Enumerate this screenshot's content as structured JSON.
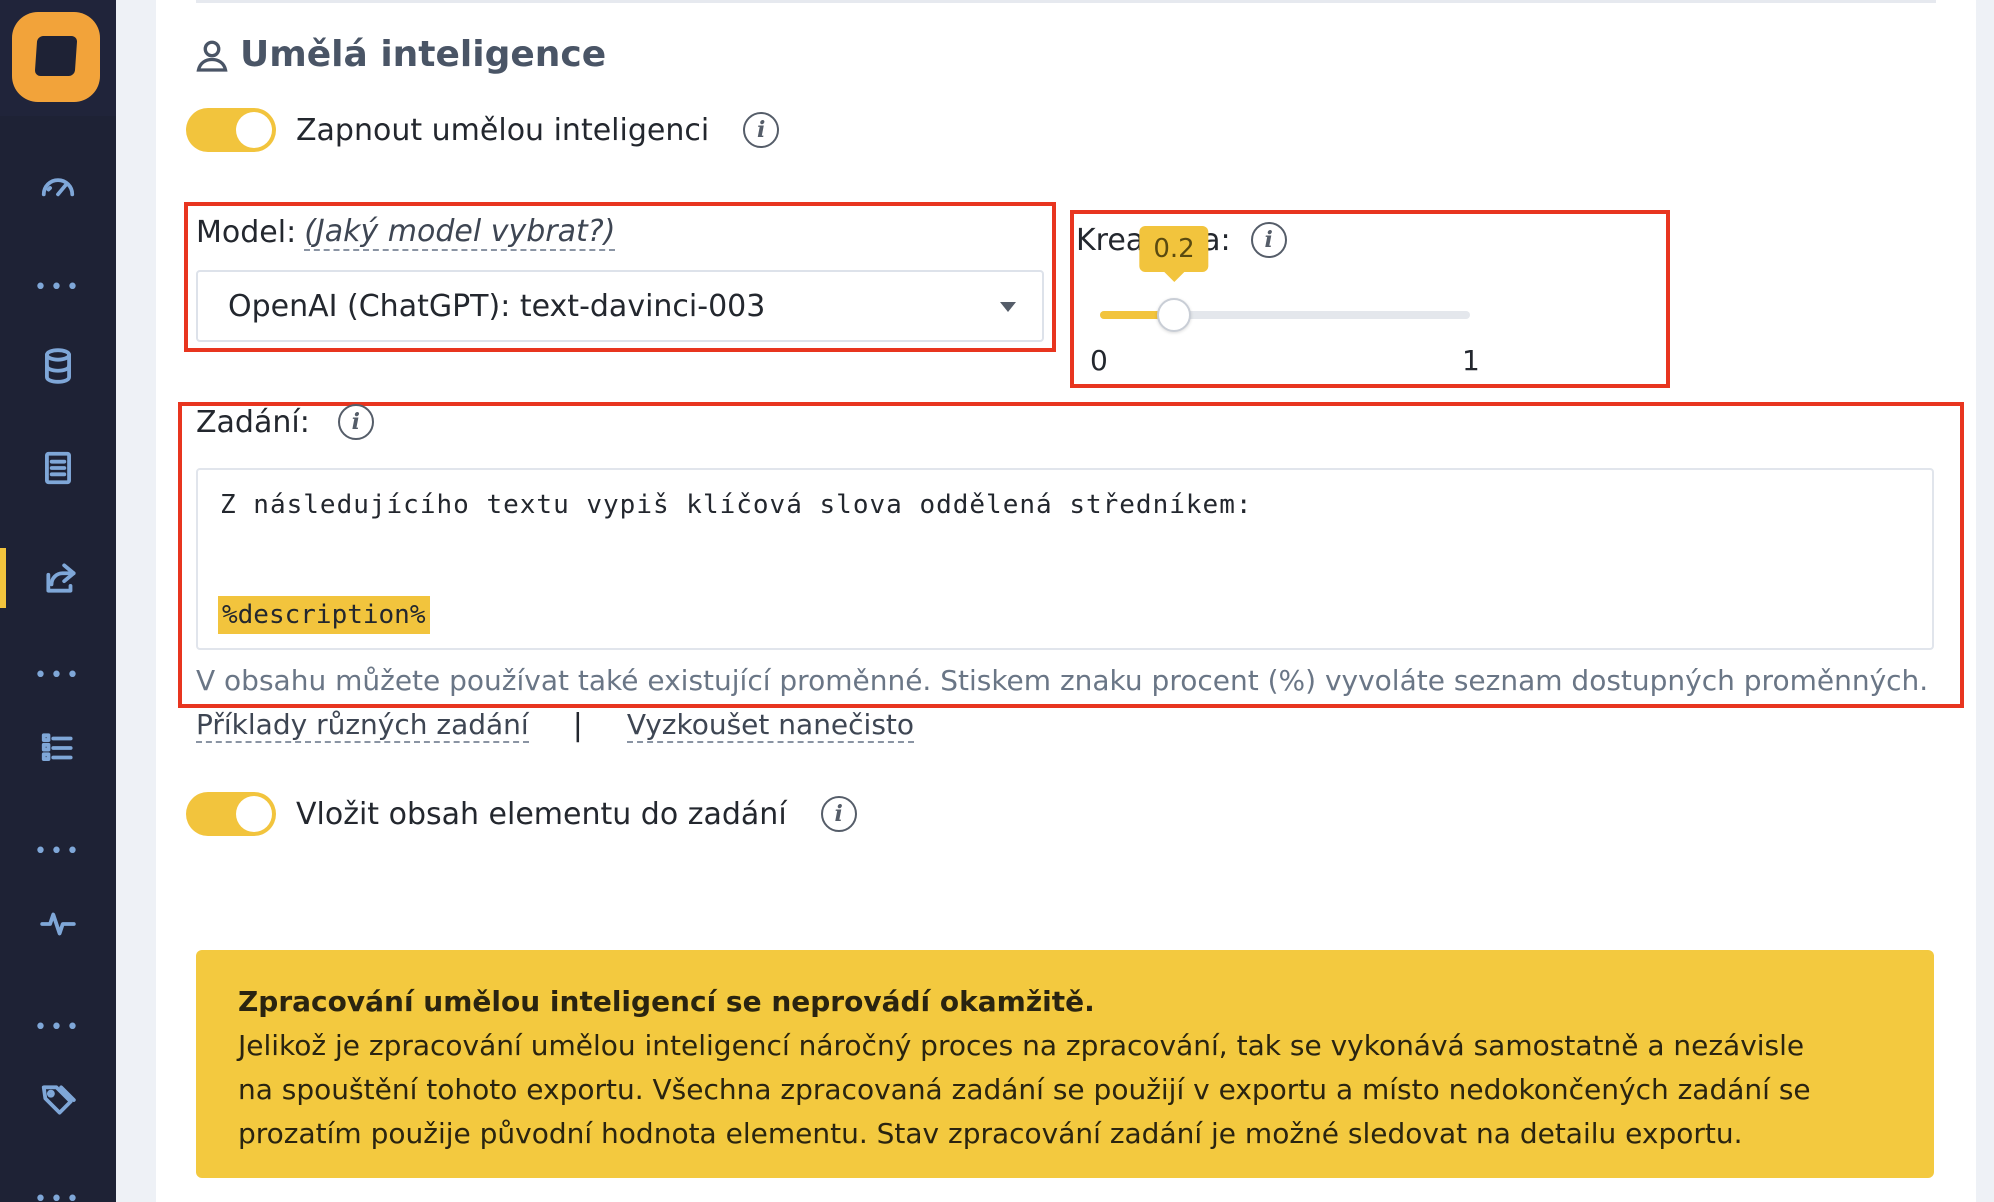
{
  "sidebar": {
    "logo": "app-logo",
    "items": [
      {
        "icon": "speedometer-icon"
      },
      {
        "icon": "database-icon"
      },
      {
        "icon": "document-icon"
      },
      {
        "icon": "export-share-icon",
        "active": true
      },
      {
        "icon": "list-icon"
      },
      {
        "icon": "activity-pulse-icon"
      },
      {
        "icon": "tags-icon"
      }
    ]
  },
  "section": {
    "title": "Umělá inteligence",
    "icon": "user-icon"
  },
  "ai_toggle": {
    "label": "Zapnout umělou inteligenci",
    "enabled": true
  },
  "model": {
    "label": "Model:",
    "help_link": "(Jaký model vybrat?)",
    "selected": "OpenAI (ChatGPT): text-davinci-003"
  },
  "creativity": {
    "label": "Kreativita:",
    "value": "0.2",
    "min": "0",
    "max": "1"
  },
  "prompt": {
    "label": "Zadání:",
    "text_line1": "Z následujícího textu vypiš klíčová slova oddělená středníkem:",
    "variable": "%description%",
    "hint": "V obsahu můžete používat také existující proměnné. Stiskem znaku procent (%) vyvoláte seznam dostupných proměnných."
  },
  "links": {
    "examples": "Příklady různých zadání",
    "separator": "|",
    "dry_run": "Vyzkoušet nanečisto"
  },
  "insert_toggle": {
    "label": "Vložit obsah elementu do zadání",
    "enabled": true
  },
  "notice": {
    "title": "Zpracování umělou inteligencí se neprovádí okamžitě.",
    "line1": "Jelikož je zpracování umělou inteligencí náročný proces na zpracování, tak se vykonává samostatně a nezávisle",
    "line2": "na spouštění tohoto exportu. Všechna zpracovaná zadání se použijí v exportu a místo nedokončených zadání se",
    "line3": "prozatím použije původní hodnota elementu. Stav zpracování zadání je možné sledovat na detailu exportu."
  },
  "colors": {
    "accent": "#f2c43d",
    "sidebar": "#1e2235",
    "highlight_box": "#e8351f",
    "logo": "#f2a33a"
  }
}
